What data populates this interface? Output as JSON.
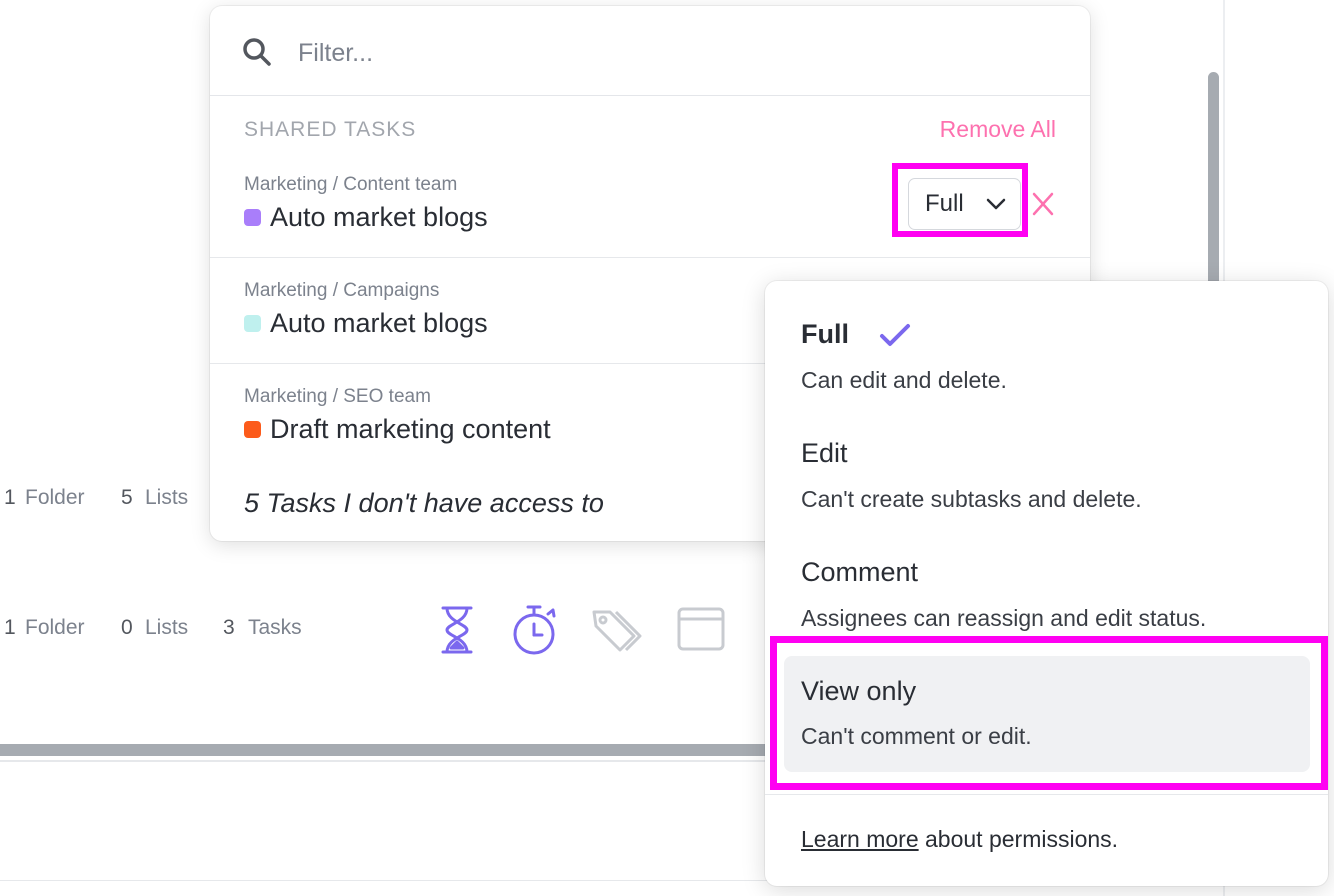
{
  "background": {
    "row1": {
      "folders_count": "1",
      "folders_label": "Folder",
      "lists_count": "5",
      "lists_label": "Lists"
    },
    "row2": {
      "folders_count": "1",
      "folders_label": "Folder",
      "lists_count": "0",
      "lists_label": "Lists",
      "tasks_count": "3",
      "tasks_label": "Tasks"
    },
    "icons": [
      "hourglass-icon",
      "stopwatch-icon",
      "tags-icon",
      "window-icon"
    ]
  },
  "share_popup": {
    "search": {
      "placeholder": "Filter...",
      "value": ""
    },
    "section_title": "SHARED TASKS",
    "remove_all": "Remove All",
    "tasks": [
      {
        "path": "Marketing / Content team",
        "name": "Auto market blogs",
        "color": "#a97efa",
        "permission": "Full"
      },
      {
        "path": "Marketing / Campaigns",
        "name": "Auto market blogs",
        "color": "#bff0ee"
      },
      {
        "path": "Marketing / SEO team",
        "name": "Draft marketing content",
        "color": "#fc5b1b"
      }
    ],
    "no_access": "5 Tasks I don't have access to"
  },
  "permission_menu": {
    "options": [
      {
        "title": "Full",
        "desc": "Can edit and delete.",
        "selected": true
      },
      {
        "title": "Edit",
        "desc": "Can't create subtasks and delete."
      },
      {
        "title": "Comment",
        "desc": "Assignees can reassign and edit status."
      },
      {
        "title": "View only",
        "desc": "Can't comment or edit.",
        "highlighted": true
      }
    ],
    "footer": {
      "link": "Learn more",
      "text": "about permissions."
    }
  },
  "colors": {
    "accent": "#7b68ee",
    "pink": "#fd71af",
    "highlight": "#ff00f2"
  }
}
